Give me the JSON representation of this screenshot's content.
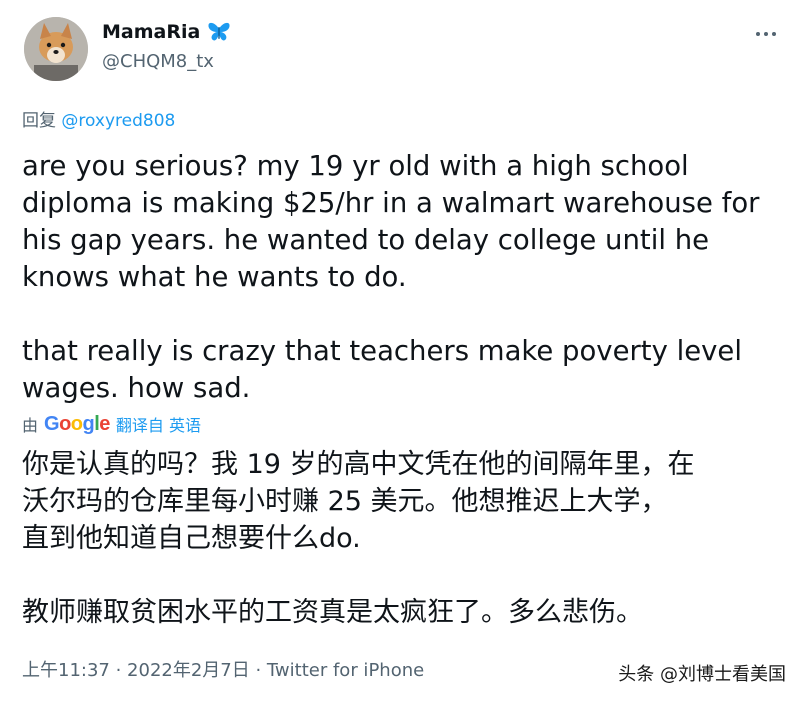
{
  "author": {
    "display_name": "MamaRia",
    "handle": "@CHQM8_tx",
    "badge_icon": "butterfly-icon"
  },
  "reply": {
    "prefix": "回复 ",
    "mention": "@roxyred808"
  },
  "tweet": {
    "paragraph_1": "are you serious? my 19 yr old with a high school\ndiploma is making $25/hr in a walmart warehouse for\nhis gap years. he wanted to delay college until he\nknows what he wants to do.",
    "paragraph_2": "that really is crazy that teachers make poverty level\nwages. how sad."
  },
  "translation": {
    "by_label": "由",
    "provider": "Google",
    "link_label": "翻译自 英语",
    "paragraph_1": "你是认真的吗？我 19 岁的高中文凭在他的间隔年里，在\n沃尔玛的仓库里每小时赚 25 美元。他想推迟上大学，\n直到他知道自己想要什么do.",
    "paragraph_2": "教师赚取贫困水平的工资真是太疯狂了。多么悲伤。"
  },
  "meta": {
    "line": "上午11:37 · 2022年2月7日 · Twitter for iPhone"
  },
  "watermark": {
    "text": "头条 @刘博士看美国"
  },
  "colors": {
    "link": "#1d9bf0",
    "secondary_text": "#536471",
    "primary_text": "#0f1419"
  }
}
